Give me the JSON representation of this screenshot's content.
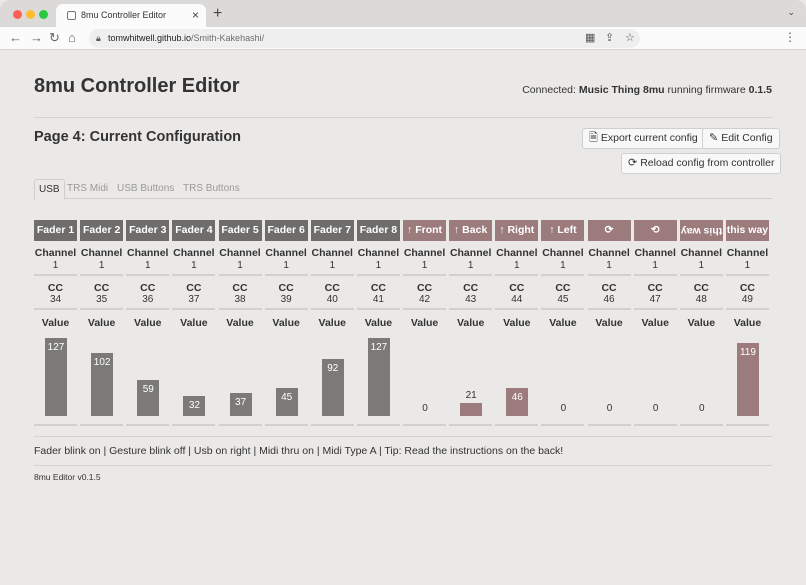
{
  "browser": {
    "tab_title": "8mu Controller Editor",
    "url_host": "tomwhitwell.github.io",
    "url_path": "/Smith-Kakehashi/",
    "traffic_colors": [
      "#fe5f57",
      "#febc2e",
      "#28c840"
    ]
  },
  "app": {
    "title": "8mu Controller Editor",
    "connection_prefix": "Connected: ",
    "device_name": "Music Thing 8mu",
    "firmware_prefix": " running firmware ",
    "firmware_version": "0.1.5"
  },
  "config": {
    "page_title": "Page 4: Current Configuration",
    "export_label": "Export current config",
    "edit_label": "Edit Config",
    "reload_label": "Reload config from controller"
  },
  "tabs": [
    {
      "label": "USB",
      "active": true
    },
    {
      "label": "TRS Midi",
      "active": false
    },
    {
      "label": "USB Buttons",
      "active": false
    },
    {
      "label": "TRS Buttons",
      "active": false
    }
  ],
  "labels": {
    "channel": "Channel",
    "cc": "CC",
    "value": "Value"
  },
  "controls": [
    {
      "name": "Fader 1",
      "kind": "fader",
      "channel": "1",
      "cc": "34",
      "value": 127
    },
    {
      "name": "Fader 2",
      "kind": "fader",
      "channel": "1",
      "cc": "35",
      "value": 102
    },
    {
      "name": "Fader 3",
      "kind": "fader",
      "channel": "1",
      "cc": "36",
      "value": 59
    },
    {
      "name": "Fader 4",
      "kind": "fader",
      "channel": "1",
      "cc": "37",
      "value": 32
    },
    {
      "name": "Fader 5",
      "kind": "fader",
      "channel": "1",
      "cc": "38",
      "value": 37
    },
    {
      "name": "Fader 6",
      "kind": "fader",
      "channel": "1",
      "cc": "39",
      "value": 45
    },
    {
      "name": "Fader 7",
      "kind": "fader",
      "channel": "1",
      "cc": "40",
      "value": 92
    },
    {
      "name": "Fader 8",
      "kind": "fader",
      "channel": "1",
      "cc": "41",
      "value": 127
    },
    {
      "name": "↑ Front",
      "kind": "gest",
      "channel": "1",
      "cc": "42",
      "value": 0
    },
    {
      "name": "↑ Back",
      "kind": "gest",
      "channel": "1",
      "cc": "43",
      "value": 21
    },
    {
      "name": "↑ Right",
      "kind": "gest",
      "channel": "1",
      "cc": "44",
      "value": 46
    },
    {
      "name": "↑ Left",
      "kind": "gest",
      "channel": "1",
      "cc": "45",
      "value": 0
    },
    {
      "name": "⟳",
      "kind": "gest",
      "channel": "1",
      "cc": "46",
      "value": 0
    },
    {
      "name": "⟲",
      "kind": "gest",
      "channel": "1",
      "cc": "47",
      "value": 0
    },
    {
      "name": "this way",
      "kind": "gest",
      "flip": true,
      "channel": "1",
      "cc": "48",
      "value": 0
    },
    {
      "name": "this way",
      "kind": "gest",
      "channel": "1",
      "cc": "49",
      "value": 119
    }
  ],
  "status_line": "Fader blink on | Gesture blink off | Usb on right | Midi thru on | Midi Type A | Tip: Read the instructions on the back!",
  "version": "8mu Editor v0.1.5"
}
